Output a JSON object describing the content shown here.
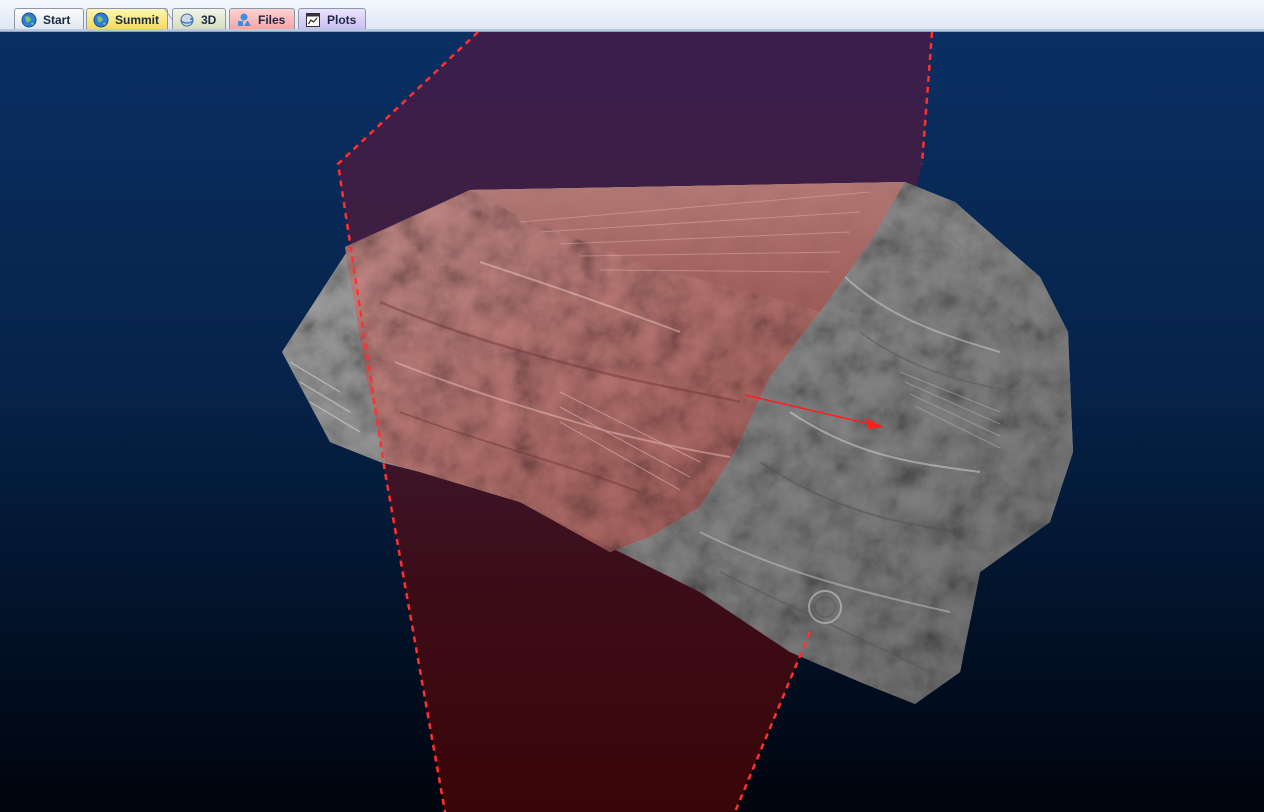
{
  "tabs": [
    {
      "label": "Start",
      "icon": "globe-icon",
      "color": "#eef2f7"
    },
    {
      "label": "Summit",
      "icon": "globe-icon",
      "color": "#f8e48a"
    },
    {
      "label": "3D",
      "icon": "rotate-3d-icon",
      "color": "#e4e9d3"
    },
    {
      "label": "Files",
      "icon": "file-shapes-icon",
      "color": "#f7b9bb"
    },
    {
      "label": "Plots",
      "icon": "plot-window-icon",
      "color": "#d9cff7"
    }
  ],
  "viewport": {
    "background_top": "#0a2f63",
    "background_bottom": "#00040c",
    "plane_color": "#8a0f14",
    "plane_outline_color": "#ff3030",
    "surface_color": "#8e8e8e",
    "highlight_color": "#c87c78",
    "arrow_color": "#ff1e1e"
  }
}
